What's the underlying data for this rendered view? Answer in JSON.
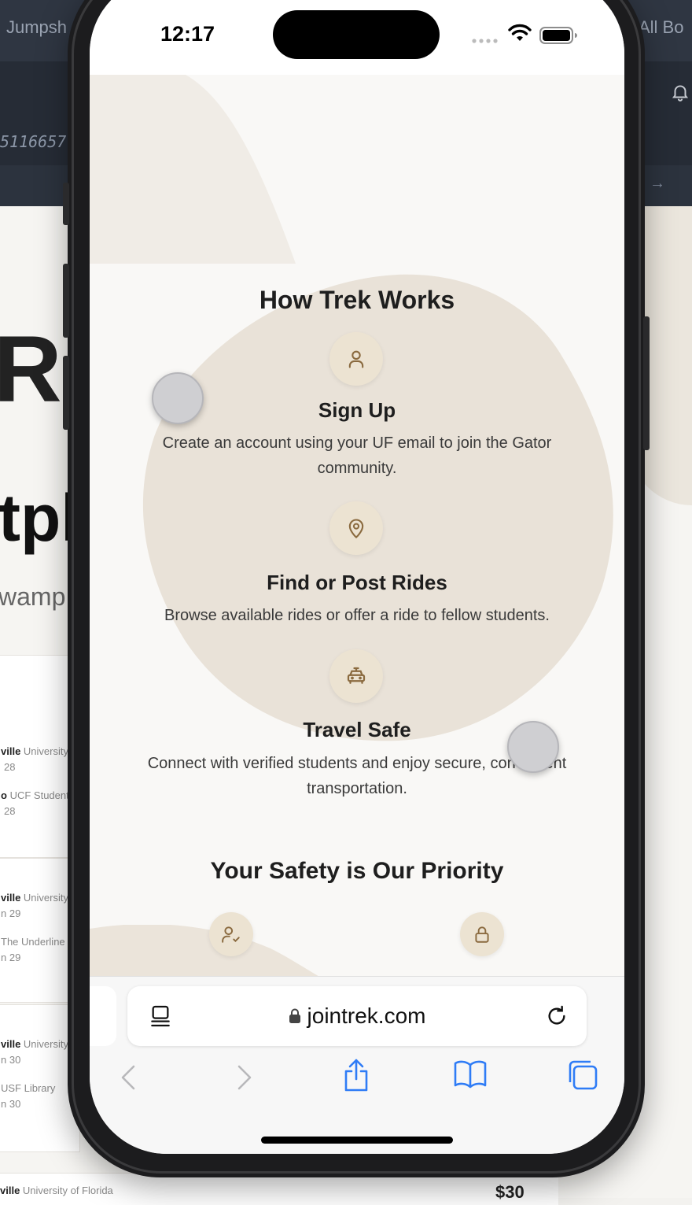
{
  "background": {
    "tab_left": "Jumpsh",
    "tab_right": "All Bo",
    "hash_text": "5116657",
    "letters": "R E",
    "word": "tpl",
    "subtitle": "wamp c",
    "listings": [
      {
        "place": "ville",
        "place2": "University",
        "date": "28"
      },
      {
        "place": "o",
        "place2": "UCF Student",
        "date": "28"
      },
      {
        "place": "ville",
        "place2": "University",
        "date": "n 29"
      },
      {
        "place": "",
        "place2": "The Underline",
        "date": "n 29"
      },
      {
        "place": "ville",
        "place2": "University",
        "date": "n 30"
      },
      {
        "place": "",
        "place2": "USF Library",
        "date": "n 30"
      }
    ],
    "bottom_listing": {
      "place": "ville",
      "place2": "University of Florida"
    },
    "price": "$30"
  },
  "status_bar": {
    "time": "12:17"
  },
  "content": {
    "section_title": "How Trek Works",
    "steps": [
      {
        "icon": "user-icon",
        "title": "Sign Up",
        "description": "Create an account using your UF email to join the Gator community."
      },
      {
        "icon": "map-pin-icon",
        "title": "Find or Post Rides",
        "description": "Browse available rides or offer a ride to fellow students."
      },
      {
        "icon": "car-icon",
        "title": "Travel Safe",
        "description": "Connect with verified students and enjoy secure, convenient transportation."
      }
    ],
    "safety_title": "Your Safety is Our Priority",
    "safety_icons": [
      "user-check-icon",
      "lock-icon"
    ]
  },
  "browser": {
    "url": "jointrek.com",
    "toolbar": [
      "back-icon",
      "forward-icon",
      "share-icon",
      "bookmarks-icon",
      "tabs-icon"
    ]
  },
  "colors": {
    "accent_brown": "#8a6a3f",
    "icon_circle": "#ece3d2",
    "blob": "#e9e2d8",
    "ios_blue": "#2f7cf6"
  }
}
